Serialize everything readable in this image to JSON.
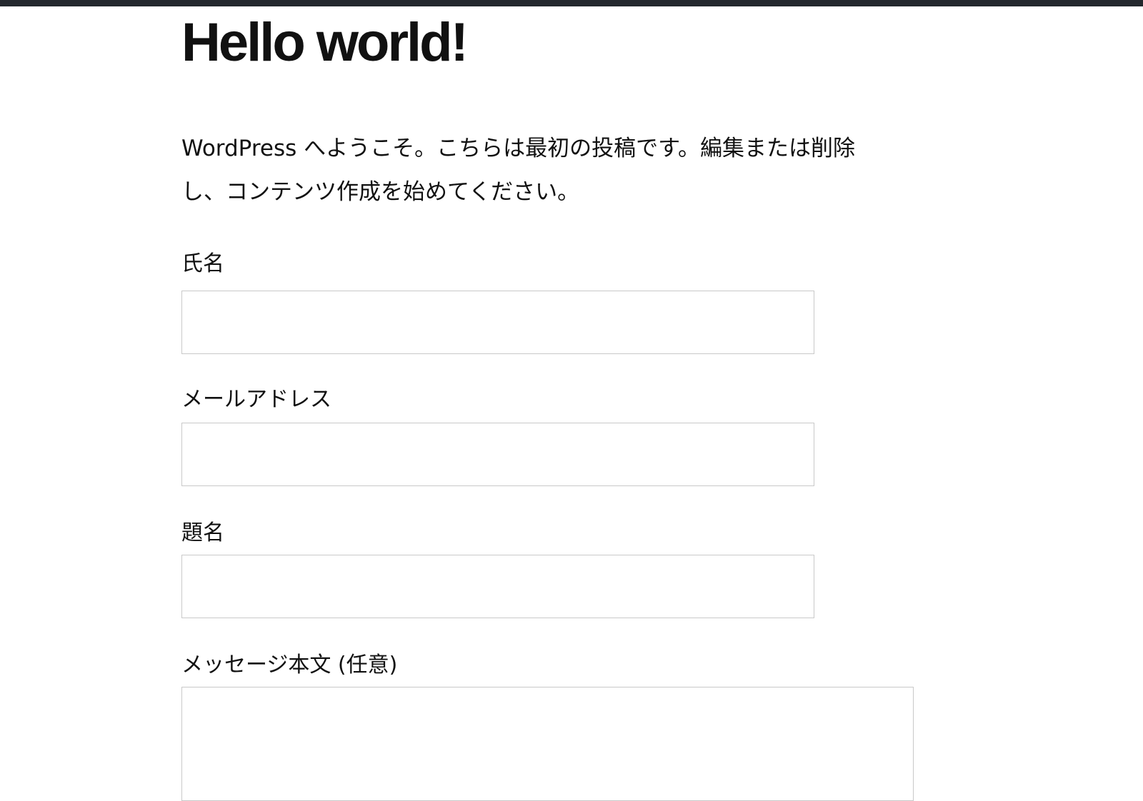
{
  "post": {
    "title": "Hello world!",
    "body": "WordPress へようこそ。こちらは最初の投稿です。編集または削除し、コンテンツ作成を始めてください。"
  },
  "form": {
    "name_label": "氏名",
    "name_value": "",
    "email_label": "メールアドレス",
    "email_value": "",
    "subject_label": "題名",
    "subject_value": "",
    "message_label": "メッセージ本文 (任意)",
    "message_value": ""
  },
  "colors": {
    "admin_bar": "#23282d",
    "text": "#111111",
    "input_border": "#c9c9c9",
    "background": "#ffffff"
  }
}
